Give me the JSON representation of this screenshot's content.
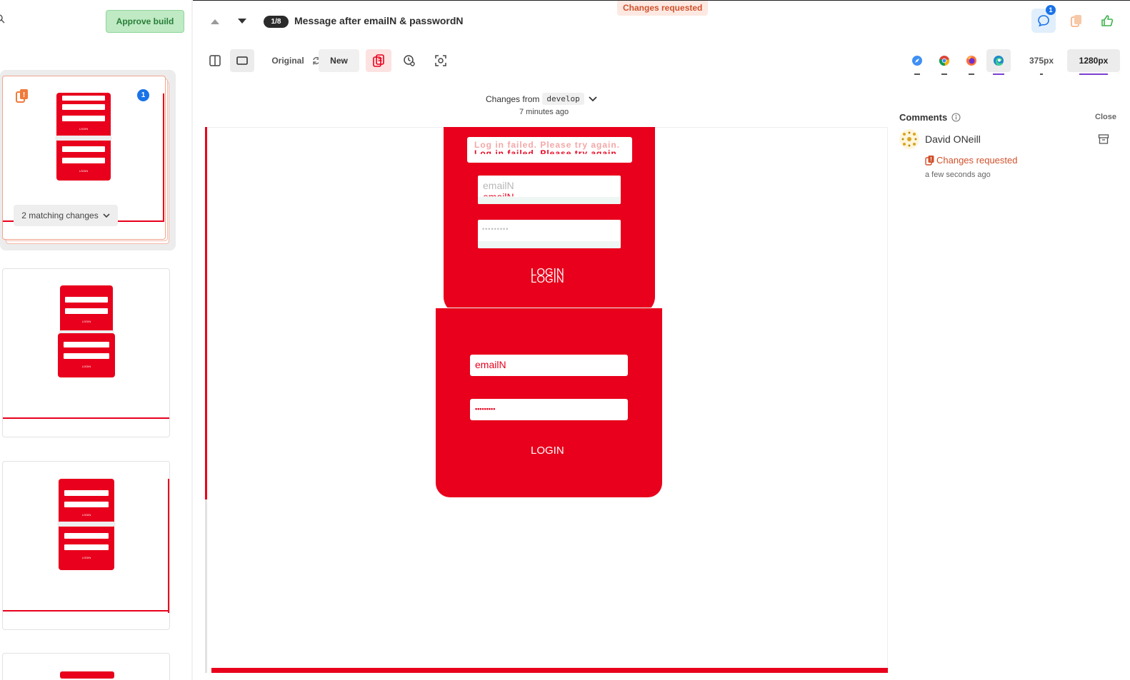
{
  "header": {
    "status_badge": "Changes requested",
    "approve_label": "Approve build",
    "counter": "1/8",
    "story_title": "Message after emailN & passwordN",
    "comment_count": "1"
  },
  "sidebar": {
    "comment_badge": "1",
    "matching_changes": "2 matching changes"
  },
  "toolbar": {
    "original_label": "Original",
    "new_label": "New",
    "viewports": [
      "375px",
      "1280px"
    ],
    "browsers": [
      "safari",
      "chrome",
      "firefox",
      "edge"
    ],
    "active_browser": "edge",
    "active_viewport": "1280px"
  },
  "comparison": {
    "changes_from_label": "Changes from",
    "branch": "develop",
    "ago": "7 minutes ago"
  },
  "preview": {
    "error_message": "Log in failed. Please try again.",
    "email_placeholder": "emailN",
    "email_value": "emailN",
    "password_mask": "•••••••••",
    "login_label": "LOGIN"
  },
  "comments": {
    "title": "Comments",
    "close_label": "Close",
    "author": "David ONeill",
    "status": "Changes requested",
    "time": "a few seconds ago"
  },
  "colors": {
    "brand_red": "#e8001c",
    "approve_green": "#bfeac4",
    "status_orange": "#d1512c",
    "accent_blue": "#1a73e8",
    "active_purple": "#7b3fcf"
  }
}
